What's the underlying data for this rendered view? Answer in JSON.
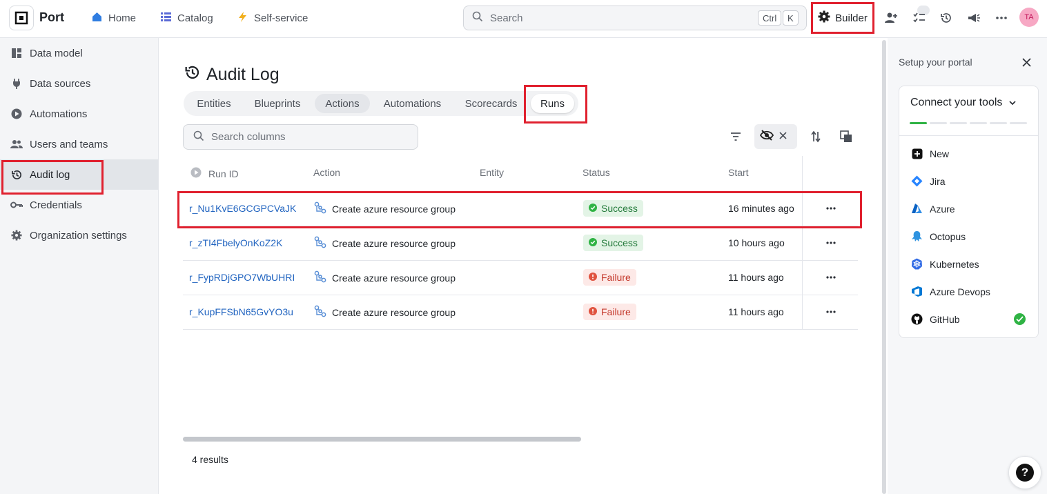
{
  "app": {
    "name": "Port",
    "avatar_initials": "TA"
  },
  "topnav": [
    {
      "label": "Home",
      "icon": "home-icon"
    },
    {
      "label": "Catalog",
      "icon": "list-icon"
    },
    {
      "label": "Self-service",
      "icon": "lightning-icon"
    }
  ],
  "search": {
    "placeholder": "Search",
    "shortcut_mod": "Ctrl",
    "shortcut_key": "K"
  },
  "builder": {
    "label": "Builder"
  },
  "sidebar": {
    "items": [
      {
        "label": "Data model",
        "icon": "data-model-icon"
      },
      {
        "label": "Data sources",
        "icon": "plug-icon"
      },
      {
        "label": "Automations",
        "icon": "play-circle-icon"
      },
      {
        "label": "Users and teams",
        "icon": "users-icon"
      },
      {
        "label": "Audit log",
        "icon": "history-icon",
        "active": true
      },
      {
        "label": "Credentials",
        "icon": "key-icon"
      },
      {
        "label": "Organization settings",
        "icon": "gear-icon"
      }
    ]
  },
  "page": {
    "title": "Audit Log",
    "tabs": [
      "Entities",
      "Blueprints",
      "Actions",
      "Automations",
      "Scorecards",
      "Runs"
    ],
    "selected_tab": "Runs",
    "column_search_placeholder": "Search columns",
    "columns": [
      "Run ID",
      "Action",
      "Entity",
      "Status",
      "Start"
    ],
    "rows": [
      {
        "run_id": "r_Nu1KvE6GCGPCVaJK",
        "action": "Create azure resource group",
        "entity": "",
        "status": "Success",
        "start": "16 minutes ago"
      },
      {
        "run_id": "r_zTI4FbelyOnKoZ2K",
        "action": "Create azure resource group",
        "entity": "",
        "status": "Success",
        "start": "10 hours ago"
      },
      {
        "run_id": "r_FypRDjGPO7WbUHRI",
        "action": "Create azure resource group",
        "entity": "",
        "status": "Failure",
        "start": "11 hours ago"
      },
      {
        "run_id": "r_KupFFSbN65GvYO3u",
        "action": "Create azure resource group",
        "entity": "",
        "status": "Failure",
        "start": "11 hours ago"
      }
    ],
    "results": "4 results"
  },
  "setup_panel": {
    "title": "Setup your portal",
    "card_title": "Connect your tools",
    "progress": {
      "done": 1,
      "total": 6
    },
    "tools": [
      {
        "label": "New",
        "icon": "plus-square-icon"
      },
      {
        "label": "Jira",
        "icon": "jira-icon"
      },
      {
        "label": "Azure",
        "icon": "azure-icon"
      },
      {
        "label": "Octopus",
        "icon": "octopus-icon"
      },
      {
        "label": "Kubernetes",
        "icon": "kubernetes-icon"
      },
      {
        "label": "Azure Devops",
        "icon": "azure-devops-icon"
      },
      {
        "label": "GitHub",
        "icon": "github-icon",
        "connected": true
      }
    ]
  },
  "colors": {
    "accent": "#2164c0",
    "highlight": "#e0202e",
    "success": "#2fb344",
    "failure": "#c4382b"
  }
}
